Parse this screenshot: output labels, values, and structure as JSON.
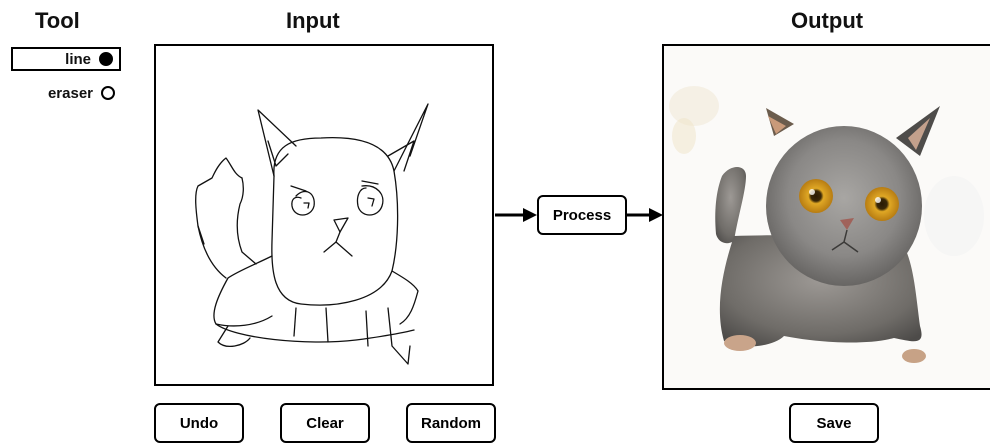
{
  "headers": {
    "tool": "Tool",
    "input": "Input",
    "output": "Output"
  },
  "tools": {
    "line": {
      "label": "line",
      "selected": true
    },
    "eraser": {
      "label": "eraser",
      "selected": false
    }
  },
  "buttons": {
    "process": "Process",
    "undo": "Undo",
    "clear": "Clear",
    "random": "Random",
    "save": "Save"
  },
  "colors": {
    "border": "#000000",
    "background": "#ffffff",
    "cat_fur": "#8c8a88",
    "cat_eye": "#d9a21a"
  },
  "icons": {
    "selected_radio": "filled-circle-icon",
    "unselected_radio": "empty-circle-icon",
    "arrow": "right-arrow-icon"
  }
}
